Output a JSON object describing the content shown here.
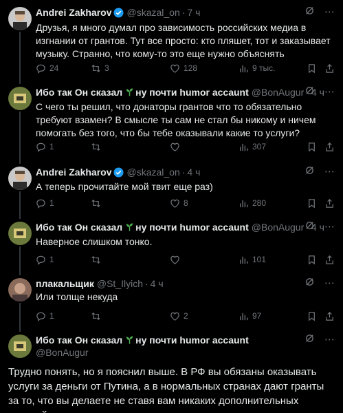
{
  "colors": {
    "background": "#000000",
    "text": "#e7e9ea",
    "muted": "#71767b",
    "verified": "#1d9bf0",
    "sprout": "#4caf50"
  },
  "tweets": [
    {
      "name": "Andrei Zakharov",
      "verified": true,
      "handle": "@skazal_on",
      "dot": "·",
      "time": "7 ч",
      "text": "Друзья, я много думал про зависимость российских медиа в изгнании от грантов. Тут все просто: кто пляшет, тот и заказывает музыку. Странно, что кому-то это еще нужно объяснять",
      "replies": "24",
      "retweets": "3",
      "likes": "128",
      "views": "9 тыс."
    },
    {
      "name": "Ибо так Он сказал",
      "name_suffix": "ну почти humor accaunt",
      "handle": "@BonAugur",
      "dot": "·",
      "time": "4 ч",
      "text": "С чего ты решил, что донаторы грантов что то обязательно требуют взамен? В смысле ты сам не стал бы никому и ничем помогать без того, что бы тебе оказывали какие то услуги?",
      "replies": "1",
      "retweets": "",
      "likes": "",
      "views": "307"
    },
    {
      "name": "Andrei Zakharov",
      "verified": true,
      "handle": "@skazal_on",
      "dot": "·",
      "time": "4 ч",
      "text": "А теперь прочитайте мой твит еще раз)",
      "replies": "1",
      "retweets": "",
      "likes": "8",
      "views": "280"
    },
    {
      "name": "Ибо так Он сказал",
      "name_suffix": "ну почти humor accaunt",
      "handle": "@BonAugur",
      "dot": "·",
      "time": "4 ч",
      "text": "Наверное слишком тонко.",
      "replies": "1",
      "retweets": "",
      "likes": "",
      "views": "101"
    },
    {
      "name": "плакальщик",
      "handle": "@St_Ilyich",
      "dot": "·",
      "time": "4 ч",
      "text": "Или толще некуда",
      "replies": "1",
      "retweets": "",
      "likes": "2",
      "views": "97"
    }
  ],
  "main_tweet": {
    "name": "Ибо так Он сказал",
    "name_suffix": "ну почти humor accaunt",
    "handle": "@BonAugur",
    "text": "Трудно понять, но я пояснил выше. В РФ вы обязаны оказывать услуги за деньги от Путина, а в нормальных странах дают гранты за то, что вы делаете не ставя вам никаких дополнительных условий"
  },
  "icons": {
    "more": "more-dots-icon",
    "grok": "grok-icon",
    "reply": "reply-icon",
    "retweet": "retweet-icon",
    "like": "heart-icon",
    "views": "views-chart-icon",
    "bookmark": "bookmark-icon",
    "share": "share-icon"
  }
}
